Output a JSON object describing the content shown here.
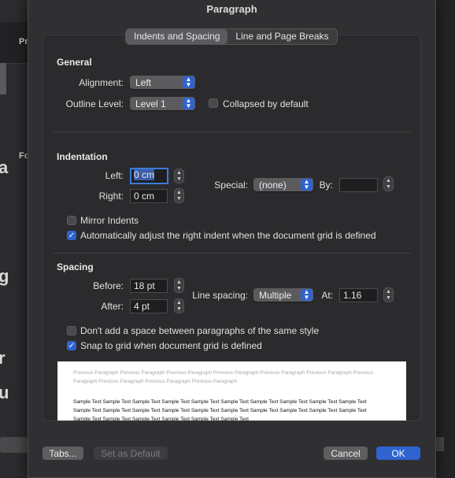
{
  "background": {
    "left_fragments": [
      "Pr",
      "Fo"
    ],
    "big_glyphs": [
      "a",
      "g",
      "r",
      "u"
    ]
  },
  "dialog": {
    "title": "Paragraph",
    "tabs": [
      {
        "label": "Indents and Spacing",
        "active": true
      },
      {
        "label": "Line and Page Breaks",
        "active": false
      }
    ]
  },
  "general": {
    "heading": "General",
    "alignment_label": "Alignment:",
    "alignment_value": "Left",
    "outline_label": "Outline Level:",
    "outline_value": "Level 1",
    "collapsed_label": "Collapsed by default",
    "collapsed_checked": false
  },
  "indentation": {
    "heading": "Indentation",
    "left_label": "Left:",
    "left_value": "0 cm",
    "right_label": "Right:",
    "right_value": "0 cm",
    "special_label": "Special:",
    "special_value": "(none)",
    "by_label": "By:",
    "by_value": "",
    "mirror_label": "Mirror Indents",
    "mirror_checked": false,
    "auto_adjust_label": "Automatically adjust the right indent when the document grid is defined",
    "auto_adjust_checked": true
  },
  "spacing": {
    "heading": "Spacing",
    "before_label": "Before:",
    "before_value": "18 pt",
    "after_label": "After:",
    "after_value": "4 pt",
    "line_spacing_label": "Line spacing:",
    "line_spacing_value": "Multiple",
    "at_label": "At:",
    "at_value": "1.16",
    "no_space_label": "Don't add a space between paragraphs of the same style",
    "no_space_checked": false,
    "snap_label": "Snap to grid when document grid is defined",
    "snap_checked": true
  },
  "preview": {
    "previous_text": "Previous Paragraph Previous Paragraph Previous Paragraph Previous Paragraph Previous Paragraph Previous Paragraph Previous Paragraph Previous Paragraph Previous Paragraph Previous Paragraph",
    "sample_text": "Sample Text Sample Text Sample Text Sample Text Sample Text Sample Text Sample Text Sample Text Sample Text Sample Text Sample Text Sample Text Sample Text Sample Text Sample Text Sample Text Sample Text Sample Text Sample Text Sample Text Sample Text Sample Text Sample Text Sample Text Sample Text Sample Text"
  },
  "buttons": {
    "tabs": "Tabs...",
    "set_default": "Set as Default",
    "cancel": "Cancel",
    "ok": "OK"
  },
  "colors": {
    "accent": "#2f63d0",
    "dialog_bg": "#303033",
    "panel_bg": "#2b2b2d"
  }
}
